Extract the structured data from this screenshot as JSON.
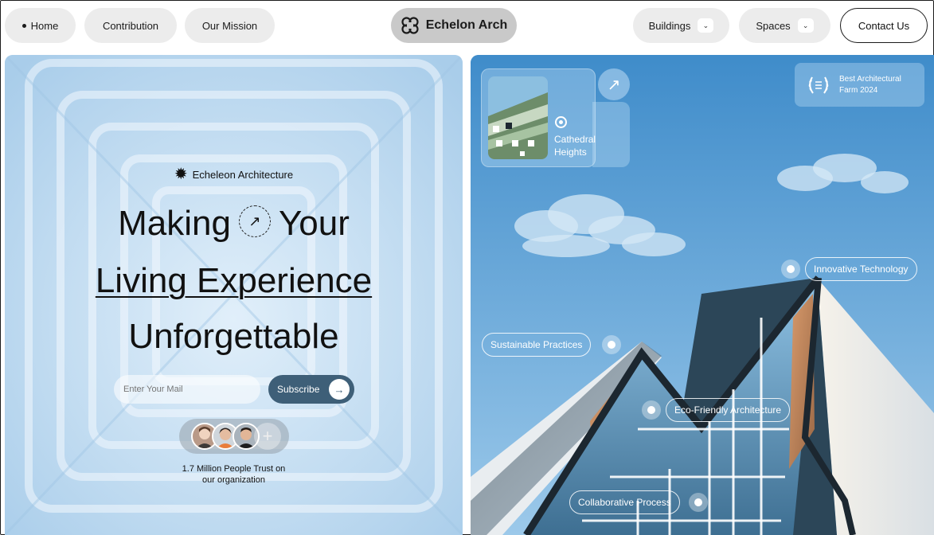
{
  "nav": {
    "home": "Home",
    "contribution": "Contribution",
    "mission": "Our Mission",
    "brand": "Echelon Arch",
    "brand_icon": "clover-logo-icon",
    "buildings": "Buildings",
    "spaces": "Spaces",
    "contact": "Contact Us"
  },
  "hero": {
    "eyebrow": "Echeleon Architecture",
    "line1_a": "Making",
    "line1_b": "Your",
    "line2": "Living Experience",
    "line3": "Unforgettable",
    "email_placeholder": "Enter Your Mail",
    "subscribe": "Subscribe",
    "trust_line1": "1.7 Million People Trust on",
    "trust_line2": "our organization"
  },
  "showcase": {
    "card_title": "Cathedral Heights",
    "award": "Best Architectural Farm 2024",
    "tags": {
      "innovative": "Innovative Technology",
      "sustainable": "Sustainable Practices",
      "eco": "Eco-Friendly Architecture",
      "collaborative": "Collaborative Process"
    }
  },
  "colors": {
    "nav_pill": "#ececec",
    "brand_pill": "#c9c9c9",
    "subscribe_bg": "#3e5f78",
    "sky": "#4a95cf",
    "left_bg": "#bcd9f1"
  }
}
